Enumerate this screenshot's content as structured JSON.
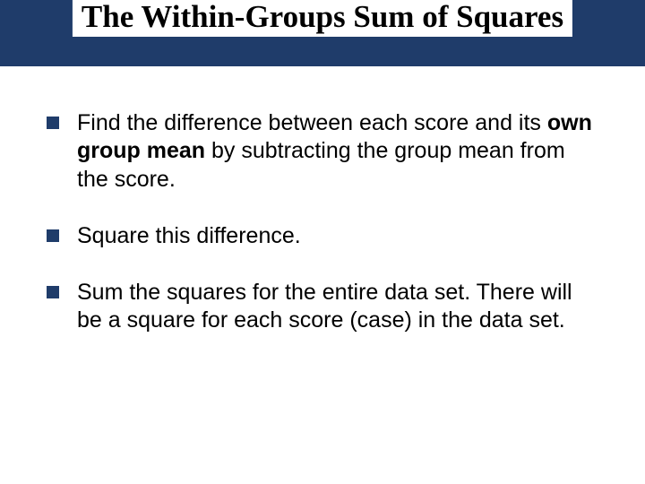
{
  "title": "The Within-Groups Sum of Squares",
  "bullets": [
    {
      "pre": "Find the difference between each score and its ",
      "bold": "own group mean",
      "post": " by subtracting the group mean from the score."
    },
    {
      "pre": "Square this difference.",
      "bold": "",
      "post": ""
    },
    {
      "pre": "Sum the squares for the entire data set. There will be a square for each score (case) in the data set.",
      "bold": "",
      "post": ""
    }
  ]
}
